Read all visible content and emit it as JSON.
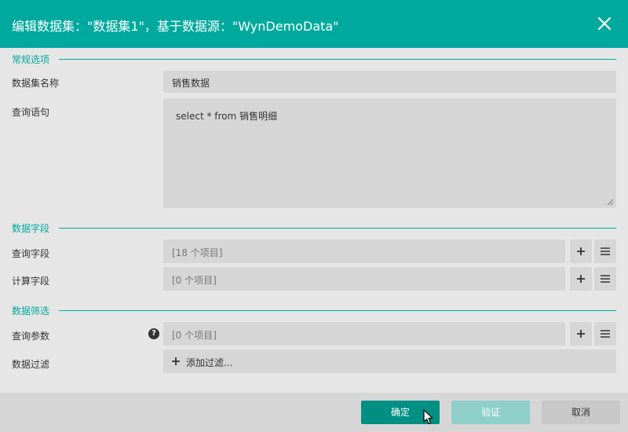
{
  "dialog": {
    "title": "编辑数据集：\"数据集1\"，基于数据源：\"WynDemoData\""
  },
  "sections": {
    "general": "常规选项",
    "fields": "数据字段",
    "filter": "数据筛选"
  },
  "general": {
    "name_label": "数据集名称",
    "name_value": "销售数据",
    "query_label": "查询语句",
    "query_value": "select * from 销售明细"
  },
  "fields": {
    "query_fields_label": "查询字段",
    "query_fields_value": "[18 个项目]",
    "calc_fields_label": "计算字段",
    "calc_fields_value": "[0 个项目]"
  },
  "filter": {
    "params_label": "查询参数",
    "params_help": "?",
    "params_value": "[0 个项目]",
    "data_filter_label": "数据过滤",
    "add_filter_label": "添加过滤..."
  },
  "footer": {
    "ok_label": "确定",
    "verify_label": "验证",
    "cancel_label": "取消"
  },
  "icons": {
    "close": "close-icon",
    "add": "plus-icon",
    "menu": "menu-icon",
    "help": "question-icon"
  },
  "colors": {
    "accent": "#00a99d",
    "ok_button": "#008f83",
    "verify_button_disabled": "#8ecfc9"
  }
}
